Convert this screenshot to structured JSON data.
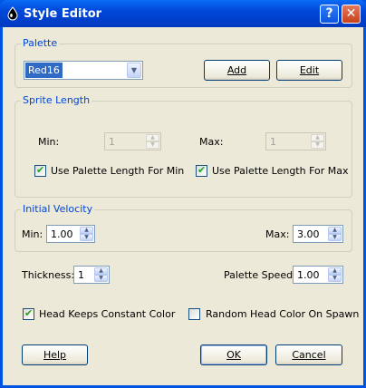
{
  "window": {
    "title": "Style Editor",
    "help_button": "?",
    "close_button": "✕"
  },
  "palette": {
    "label": "Palette",
    "selected": "Red16",
    "add_label": "Add",
    "edit_label": "Edit"
  },
  "sprite_length": {
    "label": "Sprite Length",
    "min_label": "Min:",
    "min_value": "1",
    "max_label": "Max:",
    "max_value": "1",
    "use_min_label": "Use Palette Length For Min",
    "use_min_checked": true,
    "use_max_label": "Use Palette Length For Max",
    "use_max_checked": true
  },
  "initial_velocity": {
    "label": "Initial Velocity",
    "min_label": "Min:",
    "min_value": "1.00",
    "max_label": "Max:",
    "max_value": "3.00"
  },
  "thickness": {
    "label": "Thickness:",
    "value": "1"
  },
  "palette_speed": {
    "label": "Palette Speed:",
    "value": "1.00"
  },
  "head_constant": {
    "label": "Head Keeps Constant Color",
    "checked": true
  },
  "random_head": {
    "label": "Random Head Color On Spawn",
    "checked": false
  },
  "buttons": {
    "help": "Help",
    "ok": "OK",
    "cancel": "Cancel"
  },
  "icons": {
    "spin_up": "▲",
    "spin_down": "▼",
    "dropdown": "▼",
    "check": "✔"
  }
}
